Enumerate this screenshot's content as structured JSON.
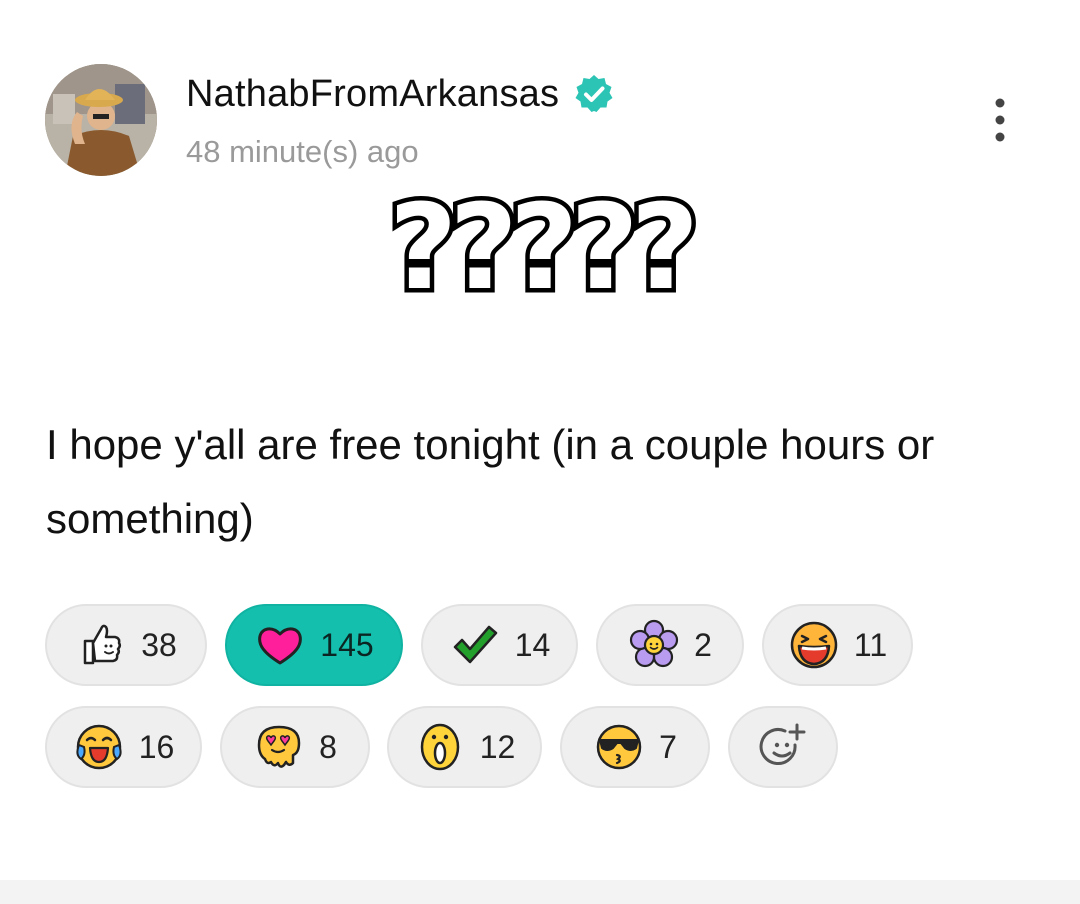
{
  "post": {
    "author": "NathabFromArkansas",
    "verified": true,
    "timestamp": "48 minute(s) ago",
    "title_text": "?????",
    "body": "I hope y'all are free tonight (in a couple hours or something)"
  },
  "reactions": [
    {
      "icon": "thumbs-up-icon",
      "count": "38",
      "active": false
    },
    {
      "icon": "heart-icon",
      "count": "145",
      "active": true
    },
    {
      "icon": "checkmark-icon",
      "count": "14",
      "active": false
    },
    {
      "icon": "flower-icon",
      "count": "2",
      "active": false
    },
    {
      "icon": "laughing-face-icon",
      "count": "11",
      "active": false
    },
    {
      "icon": "crying-laughing-face-icon",
      "count": "16",
      "active": false
    },
    {
      "icon": "melting-heart-eyes-face-icon",
      "count": "8",
      "active": false
    },
    {
      "icon": "shocked-face-icon",
      "count": "12",
      "active": false
    },
    {
      "icon": "sunglasses-kiss-face-icon",
      "count": "7",
      "active": false
    },
    {
      "icon": "add-reaction-icon",
      "count": "",
      "active": false
    }
  ],
  "colors": {
    "accent": "#14bfae",
    "verified_badge": "#2cc4b4",
    "heart": "#ff1f9a",
    "check": "#23a02c",
    "pill_bg": "#efefef",
    "muted_text": "#9a9a9a"
  }
}
